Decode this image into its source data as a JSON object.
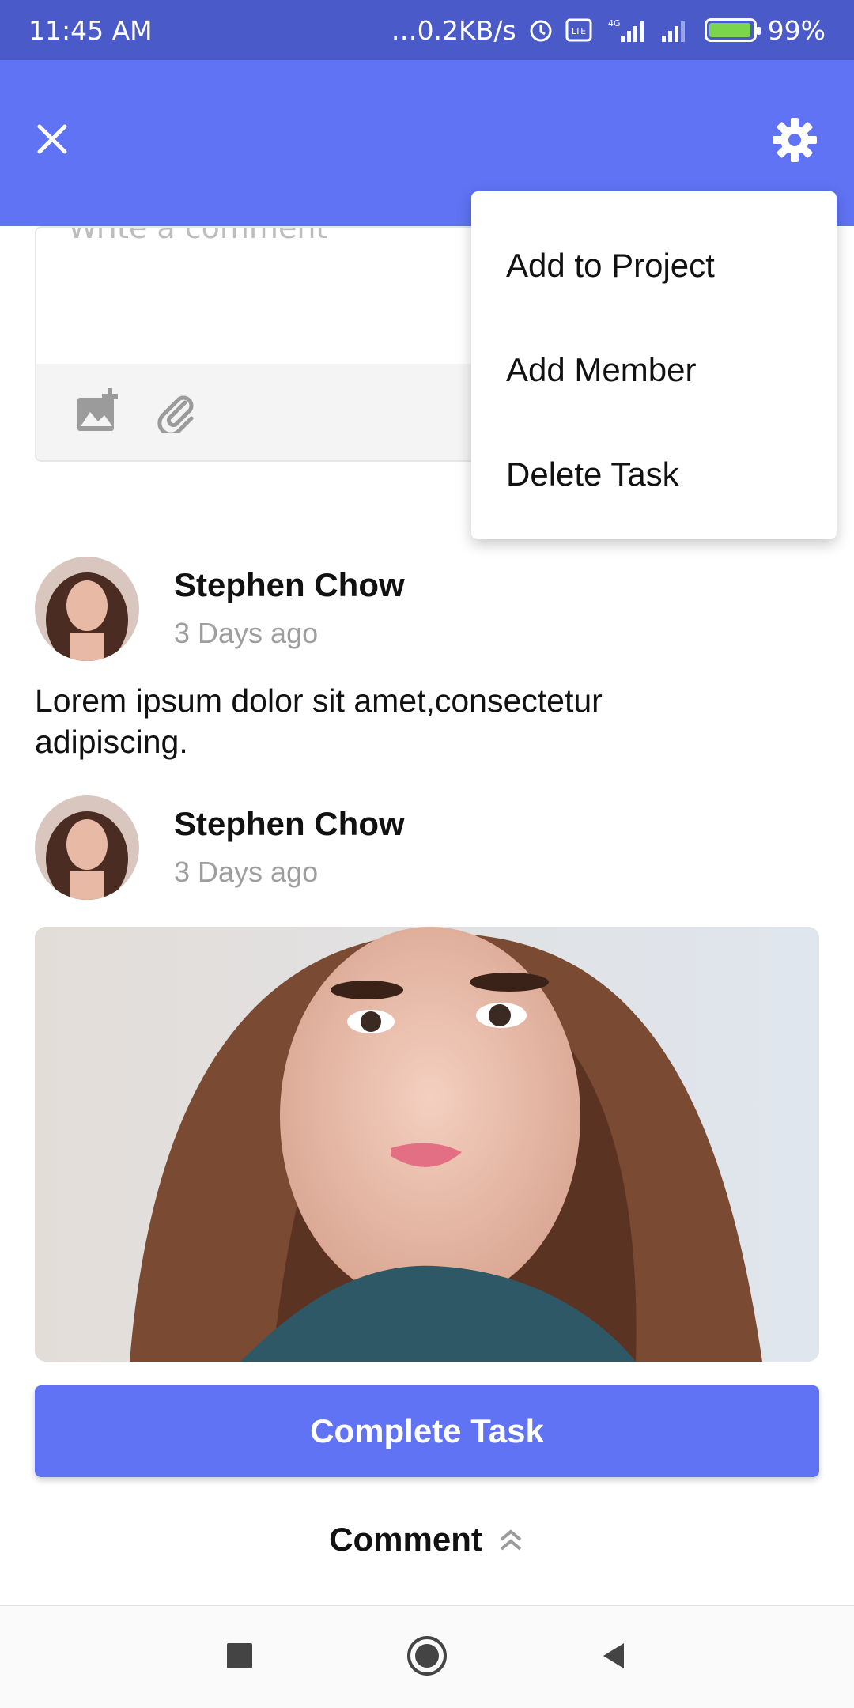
{
  "status_bar": {
    "time": "11:45 AM",
    "network_speed": "…0.2KB/s",
    "battery": "99%",
    "icons": [
      "alarm-icon",
      "volte-icon",
      "signal-4g-icon",
      "signal-icon",
      "battery-charging-icon"
    ]
  },
  "header": {
    "close_icon": "close-icon",
    "settings_icon": "gear-icon"
  },
  "composer": {
    "placeholder": "Write a comment",
    "tools": [
      "add-image-icon",
      "attachment-icon"
    ]
  },
  "menu": {
    "items": [
      {
        "label": "Add to Project"
      },
      {
        "label": "Add Member"
      },
      {
        "label": "Delete Task"
      }
    ]
  },
  "comments": [
    {
      "author": "Stephen Chow",
      "time": "3 Days ago",
      "text": "Lorem ipsum dolor sit amet,consectetur adipiscing."
    },
    {
      "author": "Stephen Chow",
      "time": "3 Days ago",
      "text": ""
    }
  ],
  "actions": {
    "complete_label": "Complete Task",
    "comment_toggle_label": "Comment"
  },
  "colors": {
    "status_bar": "#4a5bc9",
    "primary": "#5f73f4",
    "muted_text": "#9e9e9e"
  }
}
